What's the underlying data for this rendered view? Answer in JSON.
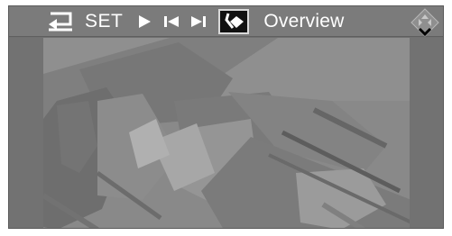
{
  "toolbar": {
    "set_label": "SET",
    "overview_label": "Overview"
  },
  "icons": {
    "back": "back-arrow-icon",
    "play": "play-icon",
    "previous": "skip-previous-icon",
    "next": "skip-next-icon",
    "route": "route-icon",
    "navigation": "navigation-diamond-icon"
  },
  "colors": {
    "toolbar_bg": "#7b7b7b",
    "screen_bg": "#6f6f6f",
    "selected_bg": "#111111",
    "text": "#ffffff"
  }
}
